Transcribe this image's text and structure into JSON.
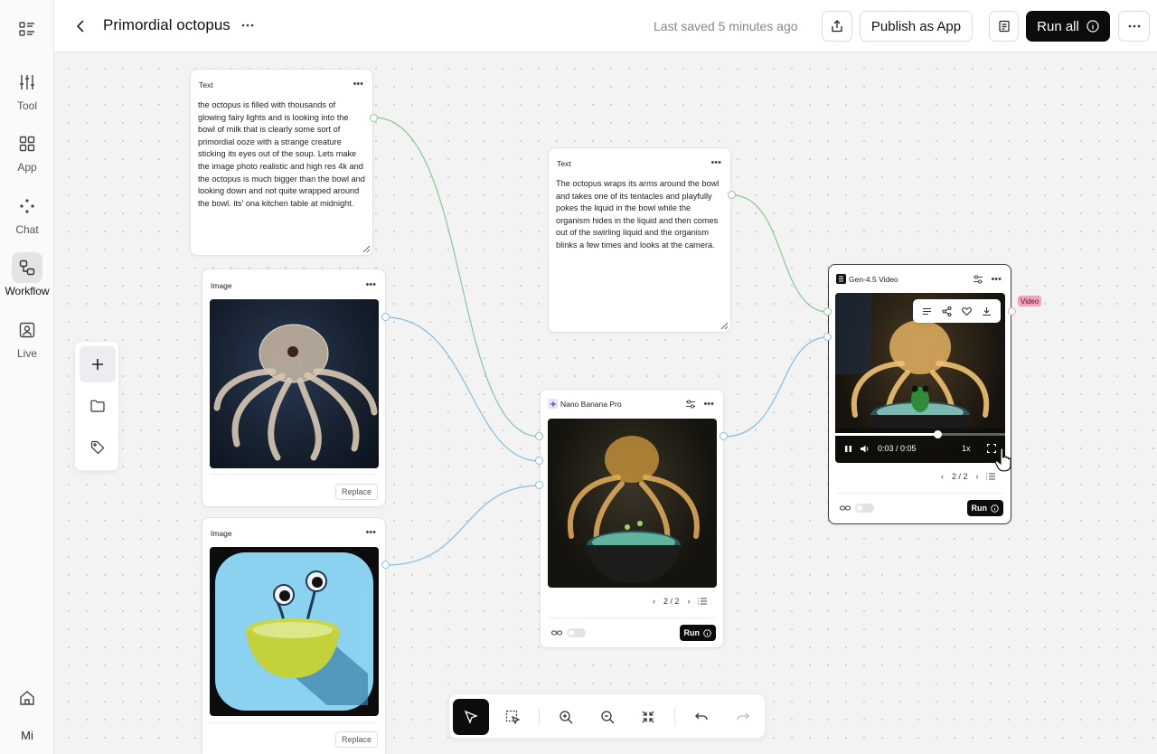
{
  "sidebar": {
    "items": [
      {
        "label": "Tool",
        "icon": "sliders-icon",
        "active": false
      },
      {
        "label": "App",
        "icon": "grid-icon",
        "active": false
      },
      {
        "label": "Chat",
        "icon": "sparkle-dots-icon",
        "active": false
      },
      {
        "label": "Workflow",
        "icon": "workflow-icon",
        "active": true
      },
      {
        "label": "Live",
        "icon": "live-portrait-icon",
        "active": false
      }
    ],
    "user_initials": "Mi"
  },
  "header": {
    "title": "Primordial octopus",
    "saved_status": "Last saved 5 minutes ago",
    "publish_label": "Publish as App",
    "run_all_label": "Run all"
  },
  "nodes": {
    "text1": {
      "title": "Text",
      "body": "the octopus is filled with thousands of glowing fairy lights and is looking into the bowl of milk that is clearly some sort of primordial ooze with a strange creature sticking its eyes out of the soup. Lets make the image photo realistic and high res 4k and the octopus is much bigger than the bowl and looking down and not quite wrapped around the bowl. its' ona kitchen table at midnight."
    },
    "text2": {
      "title": "Text",
      "body": "The octopus wraps its arms around the bowl and takes one of its tentacles and playfully pokes the liquid in the bowl while the organism hides in the liquid and then comes out of the swirling liquid and the organism blinks a few times and looks at the camera."
    },
    "image1": {
      "title": "Image",
      "replace_label": "Replace"
    },
    "image2": {
      "title": "Image",
      "replace_label": "Replace"
    },
    "nano": {
      "title": "Nano Banana Pro",
      "pager": "2 / 2",
      "run_label": "Run"
    },
    "video": {
      "title": "Gen-4.5 Video",
      "time": "0:03 / 0:05",
      "speed": "1x",
      "progress": 0.6,
      "pager": "2 / 2",
      "run_label": "Run",
      "output_tag": "Video"
    }
  },
  "colors": {
    "text_wire": "#86c98f",
    "image_wire": "#7fbde6",
    "video_tag": "#f2a2bd",
    "run_button": "#0c0c0c"
  }
}
